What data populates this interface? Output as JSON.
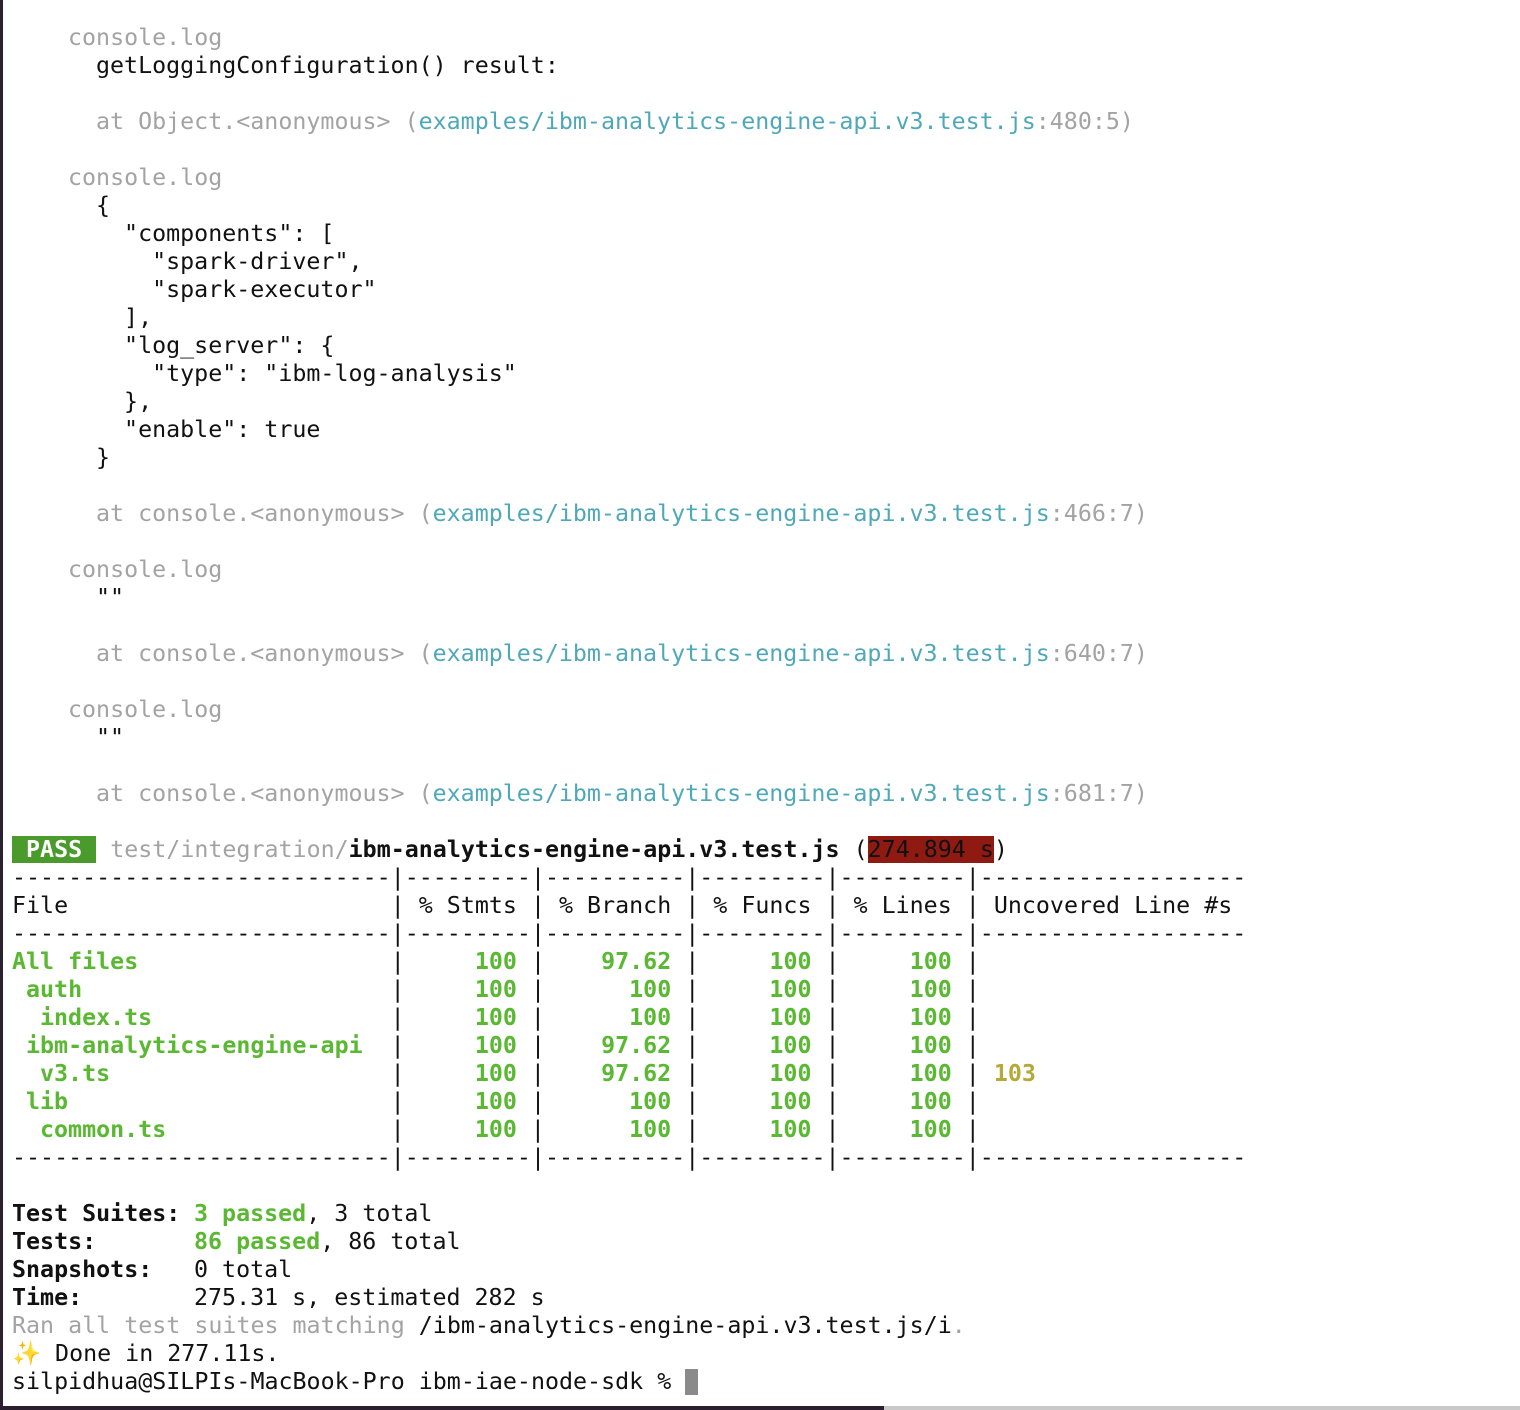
{
  "logs": [
    {
      "header": "console.log",
      "body": [
        "getLoggingConfiguration() result:"
      ],
      "location_prefix": "at Object.<anonymous> (",
      "location_file": "examples/ibm-analytics-engine-api.v3.test.js",
      "location_pos": ":480:5)"
    },
    {
      "header": "console.log",
      "body": [
        "{",
        "  \"components\": [",
        "    \"spark-driver\",",
        "    \"spark-executor\"",
        "  ],",
        "  \"log_server\": {",
        "    \"type\": \"ibm-log-analysis\"",
        "  },",
        "  \"enable\": true",
        "}"
      ],
      "location_prefix": "at console.<anonymous> (",
      "location_file": "examples/ibm-analytics-engine-api.v3.test.js",
      "location_pos": ":466:7)"
    },
    {
      "header": "console.log",
      "body": [
        "\"\""
      ],
      "location_prefix": "at console.<anonymous> (",
      "location_file": "examples/ibm-analytics-engine-api.v3.test.js",
      "location_pos": ":640:7)"
    },
    {
      "header": "console.log",
      "body": [
        "\"\""
      ],
      "location_prefix": "at console.<anonymous> (",
      "location_file": "examples/ibm-analytics-engine-api.v3.test.js",
      "location_pos": ":681:7)"
    }
  ],
  "result": {
    "status": "PASS",
    "path_dir": "test/integration/",
    "path_file": "ibm-analytics-engine-api.v3.test.js",
    "open_paren": "(",
    "duration": "274.894 s",
    "close_paren": ")"
  },
  "coverage": {
    "separator": "---------------------------|---------|----------|---------|---------|-------------------",
    "header": "File                       | % Stmts | % Branch | % Funcs | % Lines | Uncovered Line #s ",
    "rows": [
      {
        "file": "All files",
        "indent": "",
        "stmts": "100",
        "branch": "97.62",
        "funcs": "100",
        "lines": "100",
        "uncovered": ""
      },
      {
        "file": "auth",
        "indent": " ",
        "stmts": "100",
        "branch": "100",
        "funcs": "100",
        "lines": "100",
        "uncovered": ""
      },
      {
        "file": "index.ts",
        "indent": "  ",
        "stmts": "100",
        "branch": "100",
        "funcs": "100",
        "lines": "100",
        "uncovered": ""
      },
      {
        "file": "ibm-analytics-engine-api",
        "indent": " ",
        "stmts": "100",
        "branch": "97.62",
        "funcs": "100",
        "lines": "100",
        "uncovered": ""
      },
      {
        "file": "v3.ts",
        "indent": "  ",
        "stmts": "100",
        "branch": "97.62",
        "funcs": "100",
        "lines": "100",
        "uncovered": "103"
      },
      {
        "file": "lib",
        "indent": " ",
        "stmts": "100",
        "branch": "100",
        "funcs": "100",
        "lines": "100",
        "uncovered": ""
      },
      {
        "file": "common.ts",
        "indent": "  ",
        "stmts": "100",
        "branch": "100",
        "funcs": "100",
        "lines": "100",
        "uncovered": ""
      }
    ]
  },
  "summary": [
    {
      "label": "Test Suites:",
      "passed": "3 passed",
      "rest": ", 3 total"
    },
    {
      "label": "Tests:",
      "passed": "86 passed",
      "rest": ", 86 total"
    },
    {
      "label": "Snapshots:",
      "passed": "",
      "rest": "0 total"
    },
    {
      "label": "Time:",
      "passed": "",
      "rest": "275.31 s, estimated 282 s"
    }
  ],
  "ran_prefix": "Ran all test suites matching ",
  "ran_pattern": "/ibm-analytics-engine-api.v3.test.js/i",
  "ran_suffix": ".",
  "done_icon": "sparkles-icon",
  "done_glyph": "✨",
  "done_text": " Done in 277.11s.",
  "prompt": "silpidhua@SILPIs-MacBook-Pro ibm-iae-node-sdk % "
}
